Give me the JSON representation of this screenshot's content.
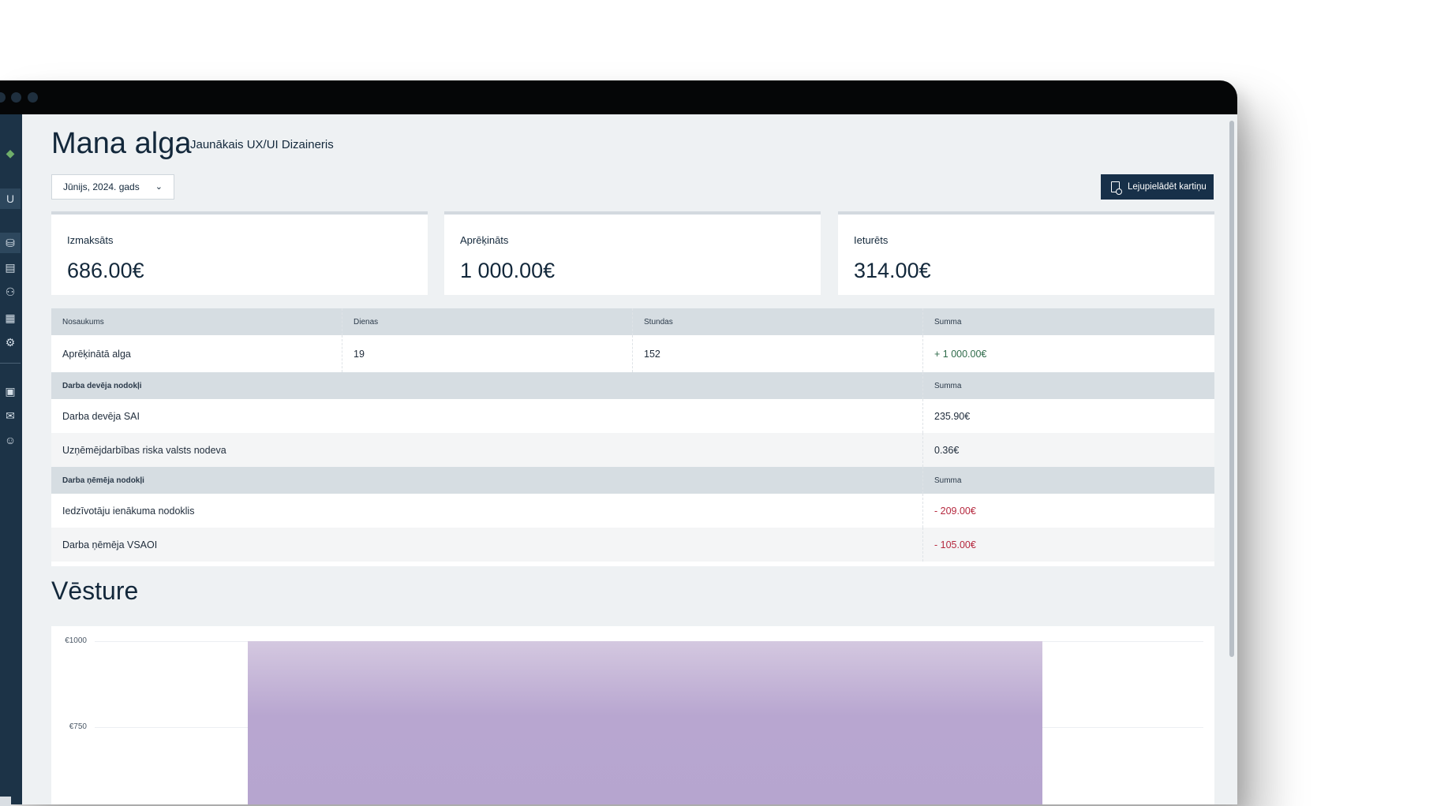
{
  "header": {
    "title": "Mana alga",
    "subtitle": "Jaunākais UX/UI Dizaineris"
  },
  "controls": {
    "month_select": "Jūnijs, 2024. gads",
    "download_button": "Lejupielādēt kartiņu"
  },
  "summary_cards": [
    {
      "label": "Izmaksāts",
      "value": "686.00€"
    },
    {
      "label": "Aprēķināts",
      "value": "1 000.00€"
    },
    {
      "label": "Ieturēts",
      "value": "314.00€"
    }
  ],
  "table": {
    "header": {
      "name": "Nosaukums",
      "days": "Dienas",
      "hours": "Stundas",
      "sum": "Summa"
    },
    "salary_row": {
      "name": "Aprēķinātā alga",
      "days": "19",
      "hours": "152",
      "sum": "+ 1 000.00€"
    },
    "employer_section": {
      "title": "Darba devēja nodokļi",
      "sum_header": "Summa",
      "rows": [
        {
          "name": "Darba devēja SAI",
          "sum": "235.90€"
        },
        {
          "name": "Uzņēmējdarbības riska valsts nodeva",
          "sum": "0.36€"
        }
      ]
    },
    "employee_section": {
      "title": "Darba ņēmēja nodokļi",
      "sum_header": "Summa",
      "rows": [
        {
          "name": "Iedzīvotāju ienākuma nodoklis",
          "sum": "- 209.00€"
        },
        {
          "name": "Darba ņēmēja VSAOI",
          "sum": "- 105.00€"
        }
      ]
    }
  },
  "history": {
    "title": "Vēsture"
  },
  "chart_data": {
    "type": "bar",
    "categories": [
      ""
    ],
    "values": [
      1000
    ],
    "yticks": [
      "€1000",
      "€750"
    ],
    "ylim": [
      0,
      1000
    ],
    "grid": true
  },
  "colors": {
    "primary": "#173049",
    "sidebar": "#1c3347",
    "positive": "#2f6b4a",
    "negative": "#b5283e",
    "bar": "#b6a5cf"
  }
}
